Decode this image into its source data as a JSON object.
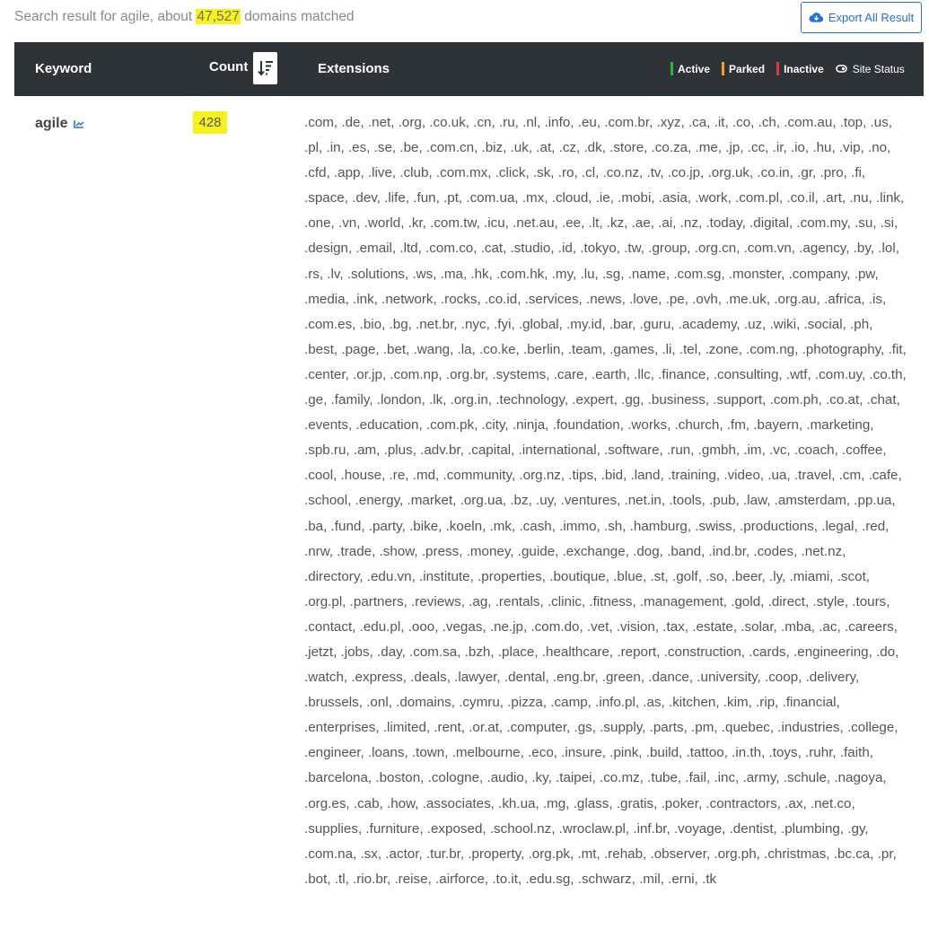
{
  "summary": {
    "prefix": "Search result for agile, about ",
    "count": "47,527",
    "suffix": " domains matched"
  },
  "export_label": "Export All Result",
  "table": {
    "headers": {
      "keyword": "Keyword",
      "count": "Count",
      "extensions": "Extensions"
    },
    "legend": {
      "active": "Active",
      "parked": "Parked",
      "inactive": "Inactive",
      "site_status": "Site Status",
      "colors": {
        "active": "#2fb344",
        "parked": "#f0a030",
        "inactive": "#e0344a"
      }
    },
    "rows": [
      {
        "keyword": "agile",
        "count": "428",
        "extensions": ".com, .de, .net, .org, .co.uk, .cn, .ru, .nl, .info, .eu, .com.br, .xyz, .ca, .it, .co, .ch, .com.au, .top, .us, .pl, .in, .es, .se, .be, .com.cn, .biz, .uk, .at, .cz, .dk, .store, .co.za, .me, .jp, .cc, .ir, .io, .hu, .vip, .no, .cfd, .app, .live, .club, .com.mx, .click, .sk, .ro, .cl, .co.nz, .tv, .co.jp, .org.uk, .co.in, .gr, .pro, .fi, .space, .dev, .life, .fun, .pt, .com.ua, .mx, .cloud, .ie, .mobi, .asia, .work, .com.pl, .co.il, .art, .nu, .link, .one, .vn, .world, .kr, .com.tw, .icu, .net.au, .ee, .lt, .kz, .ae, .ai, .nz, .today, .digital, .com.my, .su, .si, .design, .email, .ltd, .com.co, .cat, .studio, .id, .tokyo, .tw, .group, .org.cn, .com.vn, .agency, .by, .lol, .rs, .lv, .solutions, .ws, .ma, .hk, .com.hk, .my, .lu, .sg, .name, .com.sg, .monster, .company, .pw, .media, .ink, .network, .rocks, .co.id, .services, .news, .love, .pe, .ovh, .me.uk, .org.au, .africa, .is, .com.es, .bio, .bg, .net.br, .nyc, .fyi, .global, .my.id, .bar, .guru, .academy, .uz, .wiki, .social, .ph, .best, .page, .bet, .wang, .la, .co.ke, .berlin, .team, .games, .li, .tel, .zone, .com.ng, .photography, .fit, .center, .or.jp, .com.np, .org.br, .systems, .care, .earth, .llc, .finance, .consulting, .wtf, .com.uy, .co.th, .ge, .family, .london, .lk, .org.in, .technology, .expert, .gg, .business, .support, .com.ph, .co.at, .chat, .events, .education, .com.pk, .city, .ninja, .foundation, .works, .church, .fm, .bayern, .marketing, .spb.ru, .am, .plus, .adv.br, .capital, .international, .software, .run, .gmbh, .im, .vc, .coach, .coffee, .cool, .house, .re, .md, .community, .org.nz, .tips, .bid, .land, .training, .video, .ua, .travel, .cm, .cafe, .school, .energy, .market, .org.ua, .bz, .uy, .ventures, .net.in, .tools, .pub, .law, .amsterdam, .pp.ua, .ba, .fund, .party, .bike, .koeln, .mk, .cash, .immo, .sh, .hamburg, .swiss, .productions, .legal, .red, .nrw, .trade, .show, .press, .money, .guide, .exchange, .dog, .band, .ind.br, .codes, .net.nz, .directory, .edu.vn, .institute, .properties, .boutique, .blue, .st, .golf, .so, .beer, .ly, .miami, .scot, .org.pl, .partners, .reviews, .ag, .rentals, .clinic, .fitness, .management, .gold, .direct, .style, .tours, .contact, .edu.pl, .ooo, .vegas, .ne.jp, .com.do, .vet, .vision, .tax, .estate, .solar, .mba, .ac, .careers, .jetzt, .jobs, .day, .com.sa, .bzh, .place, .healthcare, .report, .construction, .cards, .engineering, .do, .watch, .express, .deals, .lawyer, .dental, .eng.br, .green, .dance, .university, .coop, .delivery, .brussels, .onl, .domains, .cymru, .pizza, .camp, .info.pl, .as, .kitchen, .kim, .rip, .financial, .enterprises, .limited, .rent, .or.at, .computer, .gs, .supply, .parts, .pm, .quebec, .industries, .college, .engineer, .loans, .town, .melbourne, .eco, .insure, .pink, .build, .tattoo, .in.th, .toys, .ruhr, .faith, .barcelona, .boston, .cologne, .audio, .ky, .taipei, .co.mz, .tube, .fail, .inc, .army, .schule, .nagoya, .org.es, .cab, .how, .associates, .kh.ua, .mg, .glass, .gratis, .poker, .contractors, .ax, .net.co, .supplies, .furniture, .exposed, .school.nz, .wroclaw.pl, .inf.br, .voyage, .dentist, .plumbing, .gy, .com.na, .sx, .actor, .tur.br, .property, .org.pk, .mt, .rehab, .observer, .org.ph, .christmas, .bc.ca, .pr, .bot, .tl, .rio.br, .reise, .airforce, .to.it, .edu.sg, .schwarz, .mil, .erni, .tk"
      }
    ]
  },
  "icons": {
    "export": "cloud-download-icon",
    "sort": "sort-descending-icon",
    "trend": "trending-up-icon",
    "status": "link-icon"
  }
}
